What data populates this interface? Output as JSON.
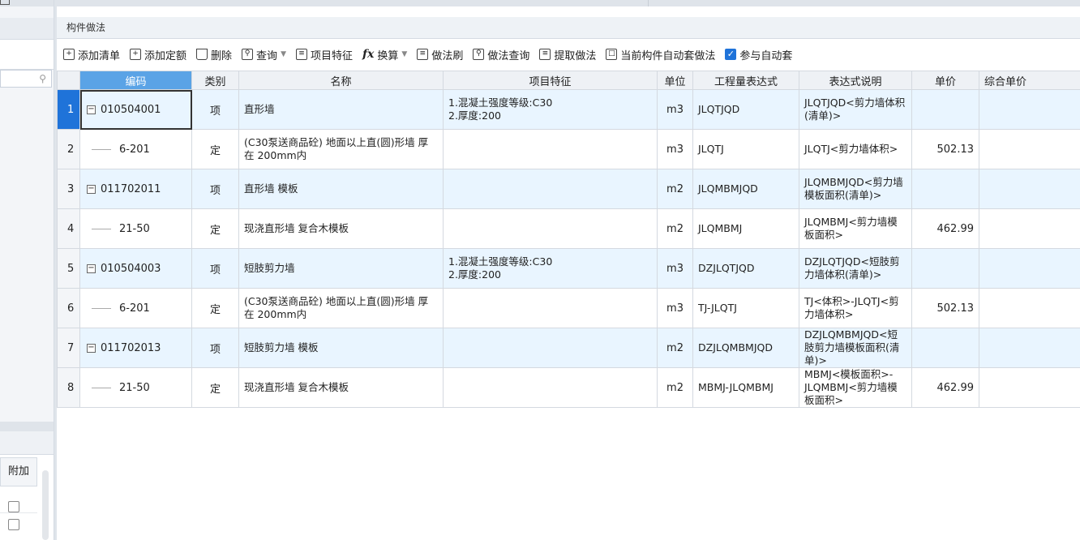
{
  "panel": {
    "title": "构件做法"
  },
  "left_panel": {
    "header": "附加"
  },
  "toolbar": {
    "add_list": "添加清单",
    "add_quota": "添加定额",
    "delete": "删除",
    "query": "查询",
    "item_features": "项目特征",
    "convert": "换算",
    "method_brush": "做法刷",
    "method_query": "做法查询",
    "extract_method": "提取做法",
    "auto_apply_current": "当前构件自动套做法",
    "join_auto_apply": "参与自动套"
  },
  "table": {
    "headers": [
      "编码",
      "类别",
      "名称",
      "项目特征",
      "单位",
      "工程量表达式",
      "表达式说明",
      "单价",
      "综合单价"
    ],
    "rows": [
      {
        "num": "1",
        "code": "010504001",
        "category": "项",
        "name": "直形墙",
        "feature": "1.混凝土强度等级:C30\n2.厚度:200",
        "unit": "m3",
        "expr": "JLQTJQD",
        "expr_desc": "JLQTJQD<剪力墙体积(清单)>",
        "price": "",
        "total_price": ""
      },
      {
        "num": "2",
        "code": "6-201",
        "category": "定",
        "name": "(C30泵送商品砼) 地面以上直(圆)形墙 厚在 200mm内",
        "feature": "",
        "unit": "m3",
        "expr": "JLQTJ",
        "expr_desc": "JLQTJ<剪力墙体积>",
        "price": "502.13",
        "total_price": ""
      },
      {
        "num": "3",
        "code": "011702011",
        "category": "项",
        "name": "直形墙 模板",
        "feature": "",
        "unit": "m2",
        "expr": "JLQMBMJQD",
        "expr_desc": "JLQMBMJQD<剪力墙模板面积(清单)>",
        "price": "",
        "total_price": ""
      },
      {
        "num": "4",
        "code": "21-50",
        "category": "定",
        "name": "现浇直形墙 复合木模板",
        "feature": "",
        "unit": "m2",
        "expr": "JLQMBMJ",
        "expr_desc": "JLQMBMJ<剪力墙模板面积>",
        "price": "462.99",
        "total_price": ""
      },
      {
        "num": "5",
        "code": "010504003",
        "category": "项",
        "name": "短肢剪力墙",
        "feature": "1.混凝土强度等级:C30\n2.厚度:200",
        "unit": "m3",
        "expr": "DZJLQTJQD",
        "expr_desc": "DZJLQTJQD<短肢剪力墙体积(清单)>",
        "price": "",
        "total_price": ""
      },
      {
        "num": "6",
        "code": "6-201",
        "category": "定",
        "name": "(C30泵送商品砼) 地面以上直(圆)形墙 厚在 200mm内",
        "feature": "",
        "unit": "m3",
        "expr": "TJ-JLQTJ",
        "expr_desc": "TJ<体积>-JLQTJ<剪力墙体积>",
        "price": "502.13",
        "total_price": ""
      },
      {
        "num": "7",
        "code": "011702013",
        "category": "项",
        "name": "短肢剪力墙 模板",
        "feature": "",
        "unit": "m2",
        "expr": "DZJLQMBMJQD",
        "expr_desc": "DZJLQMBMJQD<短肢剪力墙模板面积(清单)>",
        "price": "",
        "total_price": ""
      },
      {
        "num": "8",
        "code": "21-50",
        "category": "定",
        "name": "现浇直形墙 复合木模板",
        "feature": "",
        "unit": "m2",
        "expr": "MBMJ-JLQMBMJ",
        "expr_desc": "MBMJ<模板面积>-JLQMBMJ<剪力墙模板面积>",
        "price": "462.99",
        "total_price": ""
      }
    ]
  },
  "colors": {
    "header_selected": "#5aa3e6",
    "row_list": "#e9f5ff",
    "accent": "#1f73d9"
  }
}
